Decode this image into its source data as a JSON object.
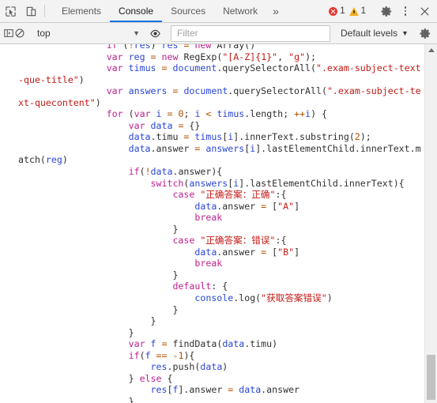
{
  "tabbar": {
    "inspect_icon": "inspect-cursor-icon",
    "device_icon": "device-toolbar-icon",
    "tabs": [
      {
        "label": "Elements",
        "active": false
      },
      {
        "label": "Console",
        "active": true
      },
      {
        "label": "Sources",
        "active": false
      },
      {
        "label": "Network",
        "active": false
      }
    ],
    "more_tabs_label": "»",
    "error_count": "1",
    "warning_count": "1",
    "settings_icon": "gear-icon",
    "more_icon": "kebab-menu-icon",
    "close_icon": "close-icon"
  },
  "console_toolbar": {
    "sidebar_icon": "console-sidebar-icon",
    "clear_icon": "clear-console-icon",
    "context_value": "top",
    "context_caret": "▼",
    "eye_icon": "live-expression-eye-icon",
    "filter_placeholder": "Filter",
    "filter_value": "",
    "levels_label": "Default levels",
    "levels_caret": "▼",
    "settings_icon": "console-settings-gear-icon"
  },
  "console_output": {
    "code_lines": [
      {
        "indent": 16,
        "tokens": [
          {
            "t": "if",
            "c": "k"
          },
          {
            "t": " (",
            "c": "pl"
          },
          {
            "t": "!",
            "c": "num"
          },
          {
            "t": "res",
            "c": "id"
          },
          {
            "t": ") ",
            "c": "pl"
          },
          {
            "t": "res",
            "c": "id"
          },
          {
            "t": " = ",
            "c": "num"
          },
          {
            "t": "new",
            "c": "k"
          },
          {
            "t": " Array()",
            "c": "pl"
          }
        ]
      },
      {
        "indent": 16,
        "tokens": [
          {
            "t": "var",
            "c": "k"
          },
          {
            "t": " ",
            "c": "pl"
          },
          {
            "t": "reg",
            "c": "id"
          },
          {
            "t": " = ",
            "c": "num"
          },
          {
            "t": "new",
            "c": "k"
          },
          {
            "t": " RegExp(",
            "c": "pl"
          },
          {
            "t": "\"[A-Z]{1}\"",
            "c": "str"
          },
          {
            "t": ", ",
            "c": "pl"
          },
          {
            "t": "\"g\"",
            "c": "str"
          },
          {
            "t": ");",
            "c": "pl"
          }
        ]
      },
      {
        "indent": 16,
        "tokens": [
          {
            "t": "var",
            "c": "k"
          },
          {
            "t": " ",
            "c": "pl"
          },
          {
            "t": "timus",
            "c": "id"
          },
          {
            "t": " = ",
            "c": "num"
          },
          {
            "t": "document",
            "c": "id"
          },
          {
            "t": ".querySelectorAll(",
            "c": "pl"
          },
          {
            "t": "\".exam-subject-text-que-title\"",
            "c": "str"
          },
          {
            "t": ")",
            "c": "pl"
          }
        ]
      },
      {
        "indent": 16,
        "tokens": [
          {
            "t": "var",
            "c": "k"
          },
          {
            "t": " ",
            "c": "pl"
          },
          {
            "t": "answers",
            "c": "id"
          },
          {
            "t": " = ",
            "c": "num"
          },
          {
            "t": "document",
            "c": "id"
          },
          {
            "t": ".querySelectorAll(",
            "c": "pl"
          },
          {
            "t": "\".exam-subject-text-quecontent\"",
            "c": "str"
          },
          {
            "t": ")",
            "c": "pl"
          }
        ]
      },
      {
        "indent": 16,
        "tokens": [
          {
            "t": "for",
            "c": "k"
          },
          {
            "t": " (",
            "c": "pl"
          },
          {
            "t": "var",
            "c": "k"
          },
          {
            "t": " ",
            "c": "pl"
          },
          {
            "t": "i",
            "c": "id"
          },
          {
            "t": " = ",
            "c": "num"
          },
          {
            "t": "0",
            "c": "num"
          },
          {
            "t": "; ",
            "c": "pl"
          },
          {
            "t": "i",
            "c": "id"
          },
          {
            "t": " < ",
            "c": "num"
          },
          {
            "t": "timus",
            "c": "id"
          },
          {
            "t": ".length; ",
            "c": "pl"
          },
          {
            "t": "++",
            "c": "num"
          },
          {
            "t": "i",
            "c": "id"
          },
          {
            "t": ") {",
            "c": "pl"
          }
        ]
      },
      {
        "indent": 20,
        "tokens": [
          {
            "t": "var",
            "c": "k"
          },
          {
            "t": " ",
            "c": "pl"
          },
          {
            "t": "data",
            "c": "id"
          },
          {
            "t": " = ",
            "c": "num"
          },
          {
            "t": "{}",
            "c": "pl"
          }
        ]
      },
      {
        "indent": 20,
        "tokens": [
          {
            "t": "data",
            "c": "id"
          },
          {
            "t": ".timu",
            "c": "pl"
          },
          {
            "t": " = ",
            "c": "num"
          },
          {
            "t": "timus",
            "c": "id"
          },
          {
            "t": "[",
            "c": "pl"
          },
          {
            "t": "i",
            "c": "id"
          },
          {
            "t": "].innerText.substring(",
            "c": "pl"
          },
          {
            "t": "2",
            "c": "num"
          },
          {
            "t": ");",
            "c": "pl"
          }
        ]
      },
      {
        "indent": 20,
        "tokens": [
          {
            "t": "data",
            "c": "id"
          },
          {
            "t": ".answer",
            "c": "pl"
          },
          {
            "t": " = ",
            "c": "num"
          },
          {
            "t": "answers",
            "c": "id"
          },
          {
            "t": "[",
            "c": "pl"
          },
          {
            "t": "i",
            "c": "id"
          },
          {
            "t": "].lastElementChild.innerText.match(",
            "c": "pl"
          },
          {
            "t": "reg",
            "c": "id"
          },
          {
            "t": ")",
            "c": "pl"
          }
        ]
      },
      {
        "indent": 20,
        "tokens": [
          {
            "t": "if",
            "c": "k"
          },
          {
            "t": "(",
            "c": "pl"
          },
          {
            "t": "!",
            "c": "num"
          },
          {
            "t": "data",
            "c": "id"
          },
          {
            "t": ".answer){",
            "c": "pl"
          }
        ]
      },
      {
        "indent": 24,
        "tokens": [
          {
            "t": "switch",
            "c": "k"
          },
          {
            "t": "(",
            "c": "pl"
          },
          {
            "t": "answers",
            "c": "id"
          },
          {
            "t": "[",
            "c": "pl"
          },
          {
            "t": "i",
            "c": "id"
          },
          {
            "t": "].lastElementChild.innerText){",
            "c": "pl"
          }
        ]
      },
      {
        "indent": 28,
        "tokens": [
          {
            "t": "case",
            "c": "k"
          },
          {
            "t": " ",
            "c": "pl"
          },
          {
            "t": "\"正确答案：正确\"",
            "c": "str"
          },
          {
            "t": ":{",
            "c": "pl"
          }
        ]
      },
      {
        "indent": 32,
        "tokens": [
          {
            "t": "data",
            "c": "id"
          },
          {
            "t": ".answer",
            "c": "pl"
          },
          {
            "t": " = ",
            "c": "num"
          },
          {
            "t": "[",
            "c": "pl"
          },
          {
            "t": "\"A\"",
            "c": "str"
          },
          {
            "t": "]",
            "c": "pl"
          }
        ]
      },
      {
        "indent": 32,
        "tokens": [
          {
            "t": "break",
            "c": "k"
          }
        ]
      },
      {
        "indent": 28,
        "tokens": [
          {
            "t": "}",
            "c": "pl"
          }
        ]
      },
      {
        "indent": 28,
        "tokens": [
          {
            "t": "case",
            "c": "k"
          },
          {
            "t": " ",
            "c": "pl"
          },
          {
            "t": "\"正确答案：错误\"",
            "c": "str"
          },
          {
            "t": ":{",
            "c": "pl"
          }
        ]
      },
      {
        "indent": 32,
        "tokens": [
          {
            "t": "data",
            "c": "id"
          },
          {
            "t": ".answer",
            "c": "pl"
          },
          {
            "t": " = ",
            "c": "num"
          },
          {
            "t": "[",
            "c": "pl"
          },
          {
            "t": "\"B\"",
            "c": "str"
          },
          {
            "t": "]",
            "c": "pl"
          }
        ]
      },
      {
        "indent": 32,
        "tokens": [
          {
            "t": "break",
            "c": "k"
          }
        ]
      },
      {
        "indent": 28,
        "tokens": [
          {
            "t": "}",
            "c": "pl"
          }
        ]
      },
      {
        "indent": 28,
        "tokens": [
          {
            "t": "default",
            "c": "k"
          },
          {
            "t": ": {",
            "c": "pl"
          }
        ]
      },
      {
        "indent": 32,
        "tokens": [
          {
            "t": "console",
            "c": "id"
          },
          {
            "t": ".log(",
            "c": "pl"
          },
          {
            "t": "\"获取答案错误\"",
            "c": "str"
          },
          {
            "t": ")",
            "c": "pl"
          }
        ]
      },
      {
        "indent": 28,
        "tokens": [
          {
            "t": "}",
            "c": "pl"
          }
        ]
      },
      {
        "indent": 24,
        "tokens": [
          {
            "t": "}",
            "c": "pl"
          }
        ]
      },
      {
        "indent": 20,
        "tokens": [
          {
            "t": "}",
            "c": "pl"
          }
        ]
      },
      {
        "indent": 20,
        "tokens": [
          {
            "t": "var",
            "c": "k"
          },
          {
            "t": " ",
            "c": "pl"
          },
          {
            "t": "f",
            "c": "id"
          },
          {
            "t": " = ",
            "c": "num"
          },
          {
            "t": "findData(",
            "c": "pl"
          },
          {
            "t": "data",
            "c": "id"
          },
          {
            "t": ".timu)",
            "c": "pl"
          }
        ]
      },
      {
        "indent": 20,
        "tokens": [
          {
            "t": "if",
            "c": "k"
          },
          {
            "t": "(",
            "c": "pl"
          },
          {
            "t": "f",
            "c": "id"
          },
          {
            "t": " == -",
            "c": "num"
          },
          {
            "t": "1",
            "c": "num"
          },
          {
            "t": "){",
            "c": "pl"
          }
        ]
      },
      {
        "indent": 24,
        "tokens": [
          {
            "t": "res",
            "c": "id"
          },
          {
            "t": ".push(",
            "c": "pl"
          },
          {
            "t": "data",
            "c": "id"
          },
          {
            "t": ")",
            "c": "pl"
          }
        ]
      },
      {
        "indent": 20,
        "tokens": [
          {
            "t": "} ",
            "c": "pl"
          },
          {
            "t": "else",
            "c": "k"
          },
          {
            "t": " {",
            "c": "pl"
          }
        ]
      },
      {
        "indent": 24,
        "tokens": [
          {
            "t": "res",
            "c": "id"
          },
          {
            "t": "[",
            "c": "pl"
          },
          {
            "t": "f",
            "c": "id"
          },
          {
            "t": "].answer",
            "c": "pl"
          },
          {
            "t": " = ",
            "c": "num"
          },
          {
            "t": "data",
            "c": "id"
          },
          {
            "t": ".answer",
            "c": "pl"
          }
        ]
      },
      {
        "indent": 20,
        "tokens": [
          {
            "t": "}",
            "c": "pl"
          }
        ]
      }
    ]
  },
  "scrollbar": {
    "up_arrow_icon": "scroll-up-arrow-icon",
    "thumb_top_pct": 86,
    "thumb_height_pct": 13
  },
  "colors": {
    "accent": "#1a73e8",
    "error": "#e53935",
    "warning": "#f2b01e",
    "keyword": "#c01f8e",
    "identifier": "#2a47d6",
    "string": "#c41a16",
    "number": "#b35000",
    "toolbar_bg": "#f3f3f3"
  }
}
